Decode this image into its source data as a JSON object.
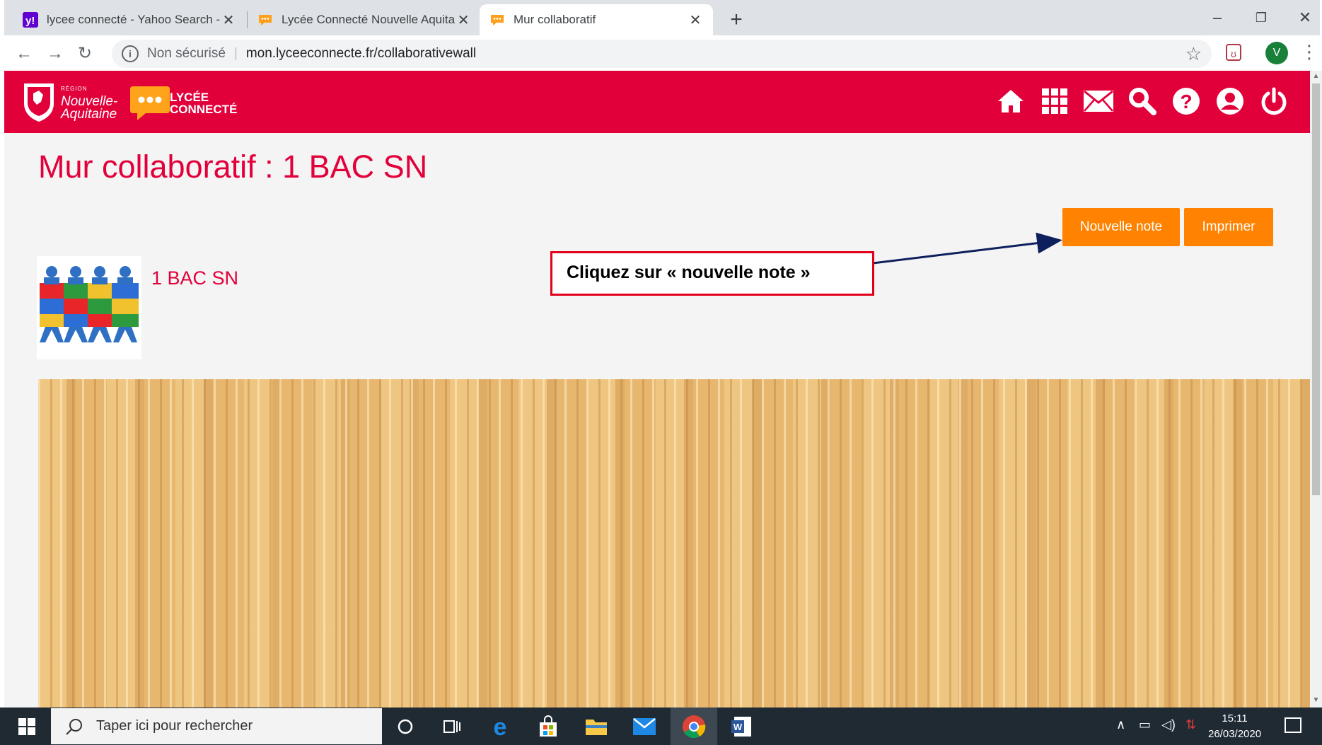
{
  "browser": {
    "tabs": [
      {
        "title": "lycee connecté - Yahoo Search - ",
        "favicon": "yahoo-icon",
        "active": false
      },
      {
        "title": "Lycée Connecté Nouvelle Aquitai",
        "favicon": "chat-bubble-icon",
        "active": false
      },
      {
        "title": "Mur collaboratif",
        "favicon": "chat-bubble-icon",
        "active": true
      }
    ],
    "new_tab": "+",
    "security_label": "Non sécurisé",
    "url": "mon.lyceeconnecte.fr/collaborativewall",
    "profile_initial": "V"
  },
  "header": {
    "region_small": "RÉGION",
    "region_line1": "Nouvelle-",
    "region_line2": "Aquitaine",
    "brand_line1": "LYCÉE",
    "brand_line2": "CONNECTÉ",
    "icons": [
      "home-icon",
      "apps-grid-icon",
      "mail-icon",
      "search-icon",
      "help-icon",
      "user-icon",
      "power-icon"
    ],
    "color": "#e2003b"
  },
  "main": {
    "title": "Mur collaboratif : 1 BAC SN",
    "new_note_button": "Nouvelle note",
    "print_button": "Imprimer",
    "wall_name": "1 BAC SN",
    "thumbnail_icon": "teamwork-puzzle-icon",
    "accent_color": "#ff8200"
  },
  "annotation": {
    "text": "Cliquez sur « nouvelle note »"
  },
  "taskbar": {
    "search_placeholder": "Taper ici pour rechercher",
    "time": "15:11",
    "date": "26/03/2020",
    "pinned": [
      "cortana-icon",
      "task-view-icon",
      "edge-icon",
      "store-icon",
      "file-explorer-icon",
      "mail-app-icon",
      "chrome-icon",
      "word-icon"
    ]
  }
}
